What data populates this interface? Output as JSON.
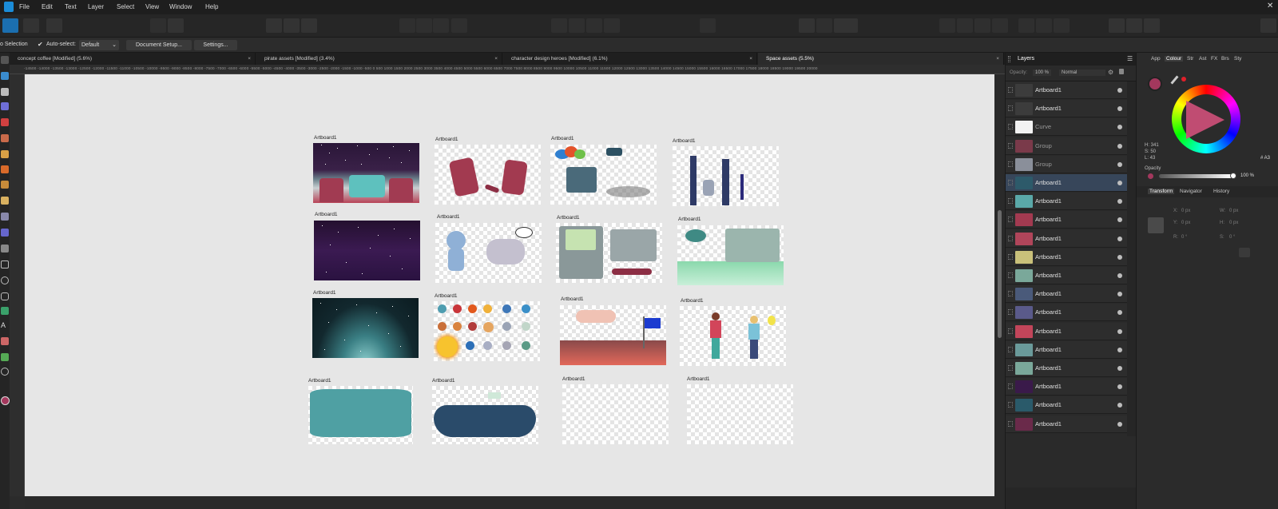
{
  "menu": {
    "items": [
      "File",
      "Edit",
      "Text",
      "Layer",
      "Select",
      "View",
      "Window",
      "Help"
    ]
  },
  "context_bar": {
    "selection_label": "o Selection",
    "auto_select_label": "Auto-select:",
    "auto_select_value": "Default",
    "document_setup": "Document Setup...",
    "settings": "Settings..."
  },
  "tabs": [
    {
      "label": "concept coffee [Modified] (5.6%)",
      "close": "×"
    },
    {
      "label": "pirate assets [Modified] (3.4%)",
      "close": "×"
    },
    {
      "label": "character design heroes [Modified] (6.1%)",
      "close": "×"
    },
    {
      "label": "Space assets (5.5%)",
      "close": "×"
    }
  ],
  "ruler": {
    "text": "-14500 -14000 -13500 -13000 -12500 -12000 -11500 -11000 -10500 -10000 -9500 -9000 -8500 -8000 -7500 -7000 -6500 -6000 -5500 -5000 -4500 -4000 -3500 -3000 -2500 -2000 -1500 -1000 -500 0 500 1000 1500 2000 2500 3000 3500 4000 4500 5000 5500 6000 6500 7000 7500 8000 8500 9000 9500 10000 10500 11000 11500 12000 12500 13000 13500 14000 14500 15000 15500 16000 16500 17000 17500 18000 18500 19000 19500 20000"
  },
  "artboards": [
    {
      "label": "Artboard1"
    },
    {
      "label": "Artboard1"
    },
    {
      "label": "Artboard1"
    },
    {
      "label": "Artboard1"
    },
    {
      "label": "Artboard1"
    },
    {
      "label": "Artboard1"
    },
    {
      "label": "Artboard1"
    },
    {
      "label": "Artboard1"
    },
    {
      "label": "Artboard1"
    },
    {
      "label": "Artboard1"
    },
    {
      "label": "Artboard1"
    },
    {
      "label": "Artboard1"
    },
    {
      "label": "Artboard1"
    },
    {
      "label": "Artboard1"
    },
    {
      "label": "Artboard1"
    },
    {
      "label": "Artboard1"
    }
  ],
  "layers_panel": {
    "title": "Layers",
    "opacity_label": "Opacity:",
    "opacity_value": "100 %",
    "blend_mode": "Normal",
    "layers": [
      {
        "name": "Artboard1",
        "selected": false,
        "dim": false
      },
      {
        "name": "Artboard1",
        "selected": false,
        "dim": false
      },
      {
        "name": "Curve",
        "selected": false,
        "dim": true
      },
      {
        "name": "Group",
        "selected": false,
        "dim": true
      },
      {
        "name": "Group",
        "selected": false,
        "dim": true
      },
      {
        "name": "Artboard1",
        "selected": true,
        "dim": false
      },
      {
        "name": "Artboard1",
        "selected": false,
        "dim": false
      },
      {
        "name": "Artboard1",
        "selected": false,
        "dim": false
      },
      {
        "name": "Artboard1",
        "selected": false,
        "dim": false
      },
      {
        "name": "Artboard1",
        "selected": false,
        "dim": false
      },
      {
        "name": "Artboard1",
        "selected": false,
        "dim": false
      },
      {
        "name": "Artboard1",
        "selected": false,
        "dim": false
      },
      {
        "name": "Artboard1",
        "selected": false,
        "dim": false
      },
      {
        "name": "Artboard1",
        "selected": false,
        "dim": false
      },
      {
        "name": "Artboard1",
        "selected": false,
        "dim": false
      },
      {
        "name": "Artboard1",
        "selected": false,
        "dim": false
      },
      {
        "name": "Artboard1",
        "selected": false,
        "dim": false
      },
      {
        "name": "Artboard1",
        "selected": false,
        "dim": false
      },
      {
        "name": "Artboard1",
        "selected": false,
        "dim": false
      }
    ]
  },
  "right_panel": {
    "tabs": [
      "App",
      "Colour",
      "Str",
      "Ast",
      "FX",
      "Brs",
      "Sty"
    ],
    "active_tab": "Colour",
    "hsl": {
      "h": "H: 341",
      "s": "S: 50",
      "l": "L: 43"
    },
    "hex": "# A3",
    "opacity_label": "Opacity",
    "opacity_value": "100 %",
    "lower_tabs": [
      "Transform",
      "Navigator",
      "History"
    ],
    "transform": {
      "x_label": "X:",
      "x_value": "0 px",
      "y_label": "Y:",
      "y_value": "0 px",
      "w_label": "W:",
      "w_value": "0 px",
      "h_label": "H:",
      "h_value": "0 px",
      "r_label": "R:",
      "r_value": "0 °",
      "s_label": "S:",
      "s_value": "0 °"
    }
  },
  "colors": {
    "accent": "#a3385d",
    "selected_layer": "#37465a",
    "canvas": "#e6e6e6"
  }
}
